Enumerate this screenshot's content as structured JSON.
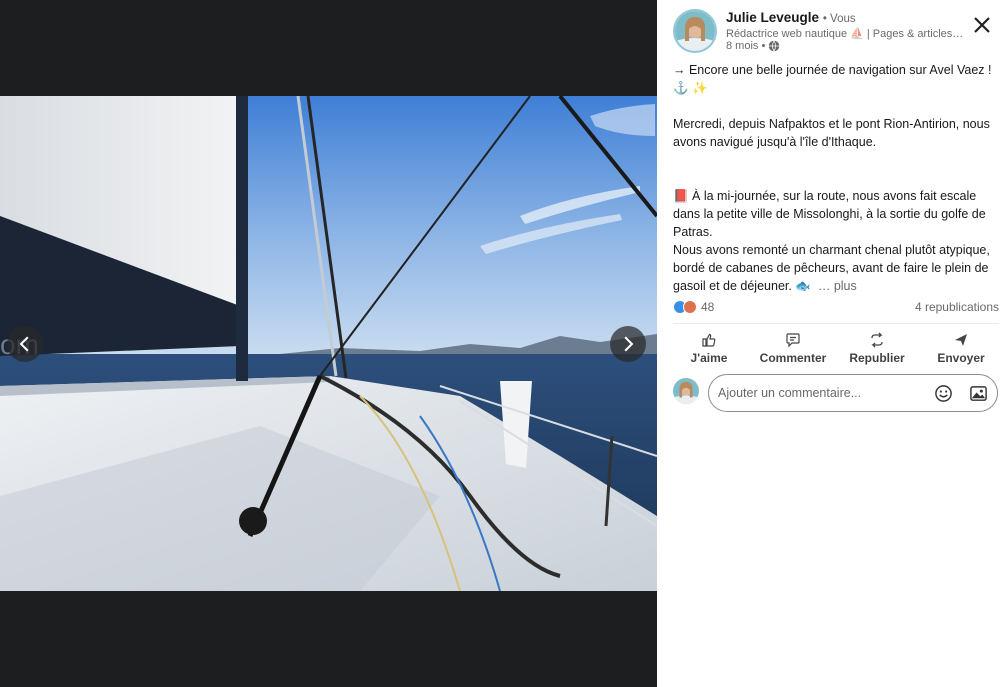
{
  "viewer": {
    "photo_alt": "",
    "prev_icon": "chevron-left-icon",
    "next_icon": "chevron-right-icon"
  },
  "post": {
    "author": {
      "name": "Julie Leveugle",
      "relationship": "• Vous",
      "headline": "Rédactrice web nautique ⛵ | Pages & articles…",
      "avatar_icon": "profile-photo"
    },
    "meta": {
      "age": "8 mois •",
      "visibility_icon": "globe-icon"
    },
    "text": {
      "line1": "→ Encore une belle journée de navigation sur Avel Vaez !",
      "line1_emojis": "⚓ ✨",
      "paragraph2": "Mercredi, depuis Nafpaktos et le pont Rion-Antirion, nous avons navigué jusqu'à l'île d'Ithaque.",
      "paragraph3a": "📕 À la mi-journée, sur la route, nous avons fait escale dans la petite ville de Missolonghi, à la sortie du golfe de Patras.",
      "paragraph3b": "Nous avons remonté un charmant chenal plutôt atypique, bordé de cabanes de pêcheurs, avant de faire le plein de gasoil et de déjeuner. 🐟",
      "see_more": "… plus"
    },
    "counts": {
      "reactions": "48",
      "reposts": "4 republications"
    },
    "actions": {
      "like": "J'aime",
      "comment": "Commenter",
      "repost": "Republier",
      "send": "Envoyer"
    },
    "comment_box": {
      "placeholder": "Ajouter un commentaire...",
      "value": ""
    }
  },
  "colors": {
    "viewer_bg": "#1d1e20",
    "panel_bg": "#ffffff",
    "like_blue": "#378fe9",
    "love_red": "#df704d"
  }
}
